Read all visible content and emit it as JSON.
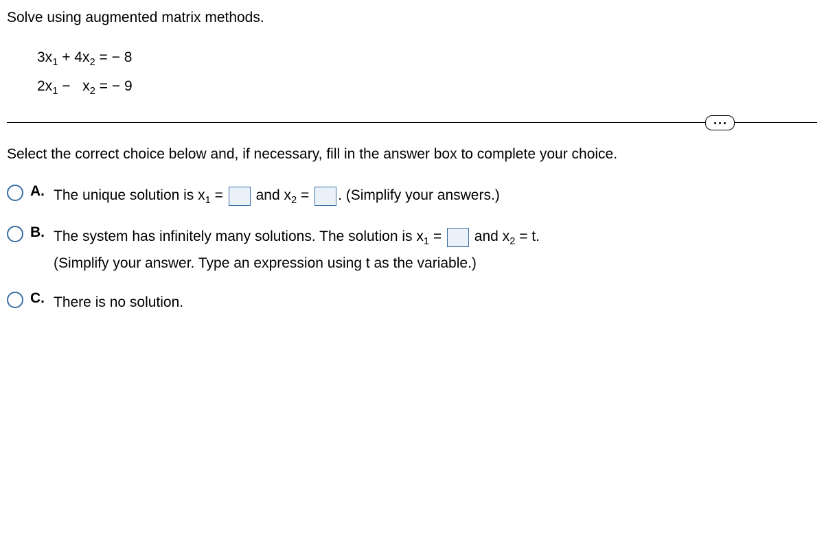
{
  "question": "Solve using augmented matrix methods.",
  "eq1": {
    "t1c": "3x",
    "t1s": "1",
    "op1": " + ",
    "t2c": "4x",
    "t2s": "2",
    "eq": " = ",
    "rhs": "− 8"
  },
  "eq2": {
    "t1c": "2x",
    "t1s": "1",
    "op1": " − ",
    "t2c": "x",
    "t2s": "2",
    "eq": " = ",
    "rhs": "− 9"
  },
  "instruction": "Select the correct choice below and, if necessary, fill in the answer box to complete your choice.",
  "choiceA": {
    "label": "A.",
    "p1": "The unique solution is x",
    "s1": "1",
    "p2": " = ",
    "p3": " and x",
    "s2": "2",
    "p4": " = ",
    "p5": ". (Simplify your answers.)"
  },
  "choiceB": {
    "label": "B.",
    "p1": "The system has infinitely many solutions. The solution is x",
    "s1": "1",
    "p2": " = ",
    "p3": " and x",
    "s2": "2",
    "p4": " = t.",
    "p5": "(Simplify your answer. Type an expression using t as the variable.)"
  },
  "choiceC": {
    "label": "C.",
    "text": "There is no solution."
  }
}
